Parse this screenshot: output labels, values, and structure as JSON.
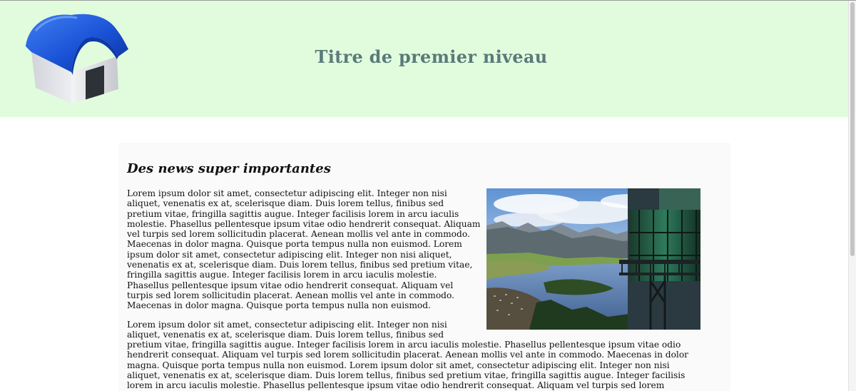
{
  "header": {
    "title": "Titre de premier niveau",
    "logo_icon": "house-icon",
    "background": "#e1fcdd",
    "title_color": "#5a7a7a"
  },
  "article": {
    "heading": "Des news super importantes",
    "image_icon": "lake-mountain-photo",
    "paragraphs": [
      "Lorem ipsum dolor sit amet, consectetur adipiscing elit. Integer non nisi aliquet, venenatis ex at, scelerisque diam. Duis lorem tellus, finibus sed pretium vitae, fringilla sagittis augue. Integer facilisis lorem in arcu iaculis molestie. Phasellus pellentesque ipsum vitae odio hendrerit consequat. Aliquam vel turpis sed lorem sollicitudin placerat. Aenean mollis vel ante in commodo. Maecenas in dolor magna. Quisque porta tempus nulla non euismod. Lorem ipsum dolor sit amet, consectetur adipiscing elit. Integer non nisi aliquet, venenatis ex at, scelerisque diam. Duis lorem tellus, finibus sed pretium vitae, fringilla sagittis augue. Integer facilisis lorem in arcu iaculis molestie. Phasellus pellentesque ipsum vitae odio hendrerit consequat. Aliquam vel turpis sed lorem sollicitudin placerat. Aenean mollis vel ante in commodo. Maecenas in dolor magna. Quisque porta tempus nulla non euismod.",
      "Lorem ipsum dolor sit amet, consectetur adipiscing elit. Integer non nisi aliquet, venenatis ex at, scelerisque diam. Duis lorem tellus, finibus sed pretium vitae, fringilla sagittis augue. Integer facilisis lorem in arcu iaculis molestie. Phasellus pellentesque ipsum vitae odio hendrerit consequat. Aliquam vel turpis sed lorem sollicitudin placerat. Aenean mollis vel ante in commodo. Maecenas in dolor magna. Quisque porta tempus nulla non euismod. Lorem ipsum dolor sit amet, consectetur adipiscing elit. Integer non nisi aliquet, venenatis ex at, scelerisque diam. Duis lorem tellus, finibus sed pretium vitae, fringilla sagittis augue. Integer facilisis lorem in arcu iaculis molestie. Phasellus pellentesque ipsum vitae odio hendrerit consequat. Aliquam vel turpis sed lorem sollicitudin placerat. Aenean mollis vel ante in commodo."
    ]
  },
  "scrollbar": {
    "icon": "vertical-scrollbar"
  }
}
